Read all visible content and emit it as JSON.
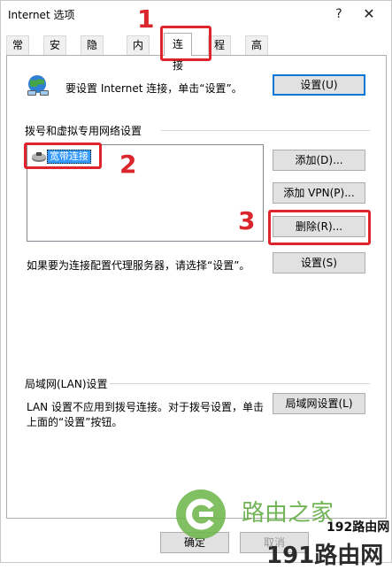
{
  "window": {
    "title": "Internet 选项",
    "help": "?",
    "close": "✕"
  },
  "tabs": [
    {
      "label": "常规"
    },
    {
      "label": "安全"
    },
    {
      "label": "隐私"
    },
    {
      "label": "内容"
    },
    {
      "label": "连接"
    },
    {
      "label": "程序"
    },
    {
      "label": "高级"
    }
  ],
  "setup": {
    "text": "要设置 Internet 连接，单击“设置”。",
    "button": "设置(U)"
  },
  "dialup": {
    "heading": "拨号和虚拟专用网络设置",
    "items": [
      {
        "label": "宽带连接"
      }
    ],
    "add_button": "添加(D)...",
    "add_vpn_button": "添加 VPN(P)...",
    "remove_button": "删除(R)...",
    "proxy_text": "如果要为连接配置代理服务器，请选择“设置”。",
    "settings_button": "设置(S)"
  },
  "lan": {
    "heading": "局域网(LAN)设置",
    "text_line1": "LAN 设置不应用到拨号连接。对于拨号设置，单击",
    "text_line2": "上面的“设置”按钮。",
    "button": "局域网设置(L)"
  },
  "footer": {
    "ok": "确定",
    "cancel": "取消"
  },
  "annotations": {
    "n1": "1",
    "n2": "2",
    "n3": "3"
  },
  "watermark": {
    "brand": "路由之家",
    "site1": "192路由网",
    "site2": "191路由网"
  },
  "colors": {
    "accent": "#0078d7",
    "annotation_red": "#e0242b",
    "selection": "#3399ff"
  }
}
